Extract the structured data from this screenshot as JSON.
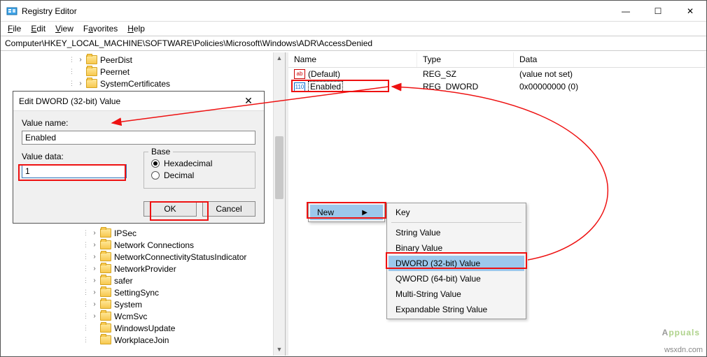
{
  "window": {
    "title": "Registry Editor",
    "controls": {
      "min": "—",
      "max": "☐",
      "close": "✕"
    }
  },
  "menubar": {
    "file": "File",
    "edit": "Edit",
    "view": "View",
    "favorites": "Favorites",
    "help": "Help"
  },
  "address": {
    "path": "Computer\\HKEY_LOCAL_MACHINE\\SOFTWARE\\Policies\\Microsoft\\Windows\\ADR\\AccessDenied"
  },
  "treeTop": [
    {
      "name": "PeerDist",
      "exp": true
    },
    {
      "name": "Peernet",
      "exp": false
    },
    {
      "name": "SystemCertificates",
      "exp": true
    }
  ],
  "treeBottom": [
    {
      "name": "IPSec",
      "exp": true
    },
    {
      "name": "Network Connections",
      "exp": true
    },
    {
      "name": "NetworkConnectivityStatusIndicator",
      "exp": true
    },
    {
      "name": "NetworkProvider",
      "exp": true
    },
    {
      "name": "safer",
      "exp": true
    },
    {
      "name": "SettingSync",
      "exp": true
    },
    {
      "name": "System",
      "exp": true
    },
    {
      "name": "WcmSvc",
      "exp": true
    },
    {
      "name": "WindowsUpdate",
      "exp": false
    },
    {
      "name": "WorkplaceJoin",
      "exp": false
    }
  ],
  "listCols": {
    "name": "Name",
    "type": "Type",
    "data": "Data"
  },
  "listRows": [
    {
      "iconLabel": "ab",
      "iconClass": "sz",
      "name": "(Default)",
      "type": "REG_SZ",
      "data": "(value not set)"
    },
    {
      "iconLabel": "110",
      "iconClass": "dw",
      "name": "Enabled",
      "type": "REG_DWORD",
      "data": "0x00000000 (0)",
      "editing": true
    }
  ],
  "dialog": {
    "title": "Edit DWORD (32-bit) Value",
    "valueNameLabel": "Value name:",
    "valueName": "Enabled",
    "valueDataLabel": "Value data:",
    "valueData": "1",
    "baseLabel": "Base",
    "hex": "Hexadecimal",
    "dec": "Decimal",
    "ok": "OK",
    "cancel": "Cancel"
  },
  "newMenu": {
    "trigger": "New",
    "items": [
      "Key",
      "String Value",
      "Binary Value",
      "DWORD (32-bit) Value",
      "QWORD (64-bit) Value",
      "Multi-String Value",
      "Expandable String Value"
    ],
    "highlightedIndex": 3
  },
  "watermark": {
    "text_a": "A",
    "text_b": "ppuals"
  },
  "credit": "wsxdn.com"
}
